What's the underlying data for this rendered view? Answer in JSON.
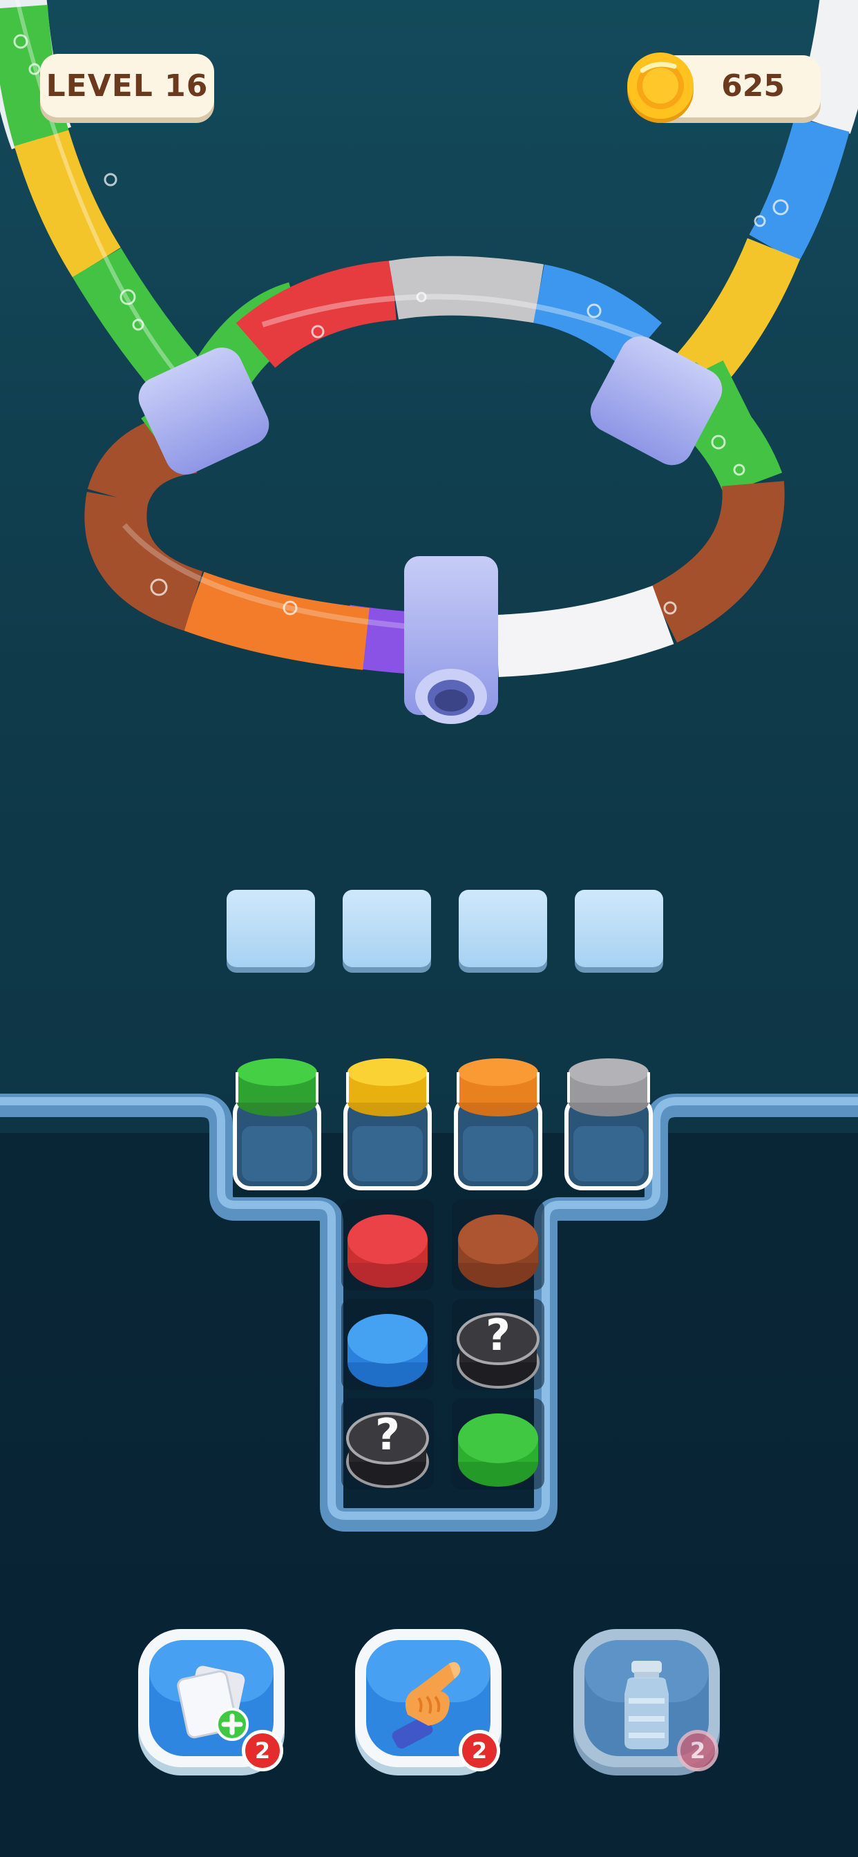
{
  "hud": {
    "level_label": "LEVEL 16",
    "coins": "625"
  },
  "pipe_segments": {
    "outer_left": [
      "white",
      "green",
      "yellow",
      "green"
    ],
    "outer_right": [
      "white",
      "blue",
      "yellow",
      "green"
    ],
    "inner_top": [
      "green",
      "red",
      "gray",
      "blue"
    ],
    "inner_bottom": [
      "brown",
      "orange",
      "purple",
      "white",
      "brown"
    ]
  },
  "slots": {
    "count": 4,
    "filled": 0
  },
  "tray": {
    "top_row": [
      "green",
      "yellow",
      "orange",
      "gray"
    ],
    "column_left": [
      "red",
      "blue",
      "hidden"
    ],
    "column_right": [
      "brown",
      "hidden",
      "green"
    ],
    "hidden_symbol": "?"
  },
  "colors": {
    "green": "#3dc93f",
    "yellow": "#f5c623",
    "orange": "#f7922c",
    "gray": "#a9a9ad",
    "red": "#e63b3f",
    "brown": "#a5502d",
    "blue": "#3d97ef",
    "hidden": "#3a3a3e",
    "purple": "#8b52e6",
    "white": "#f4f4f6"
  },
  "boosters": [
    {
      "name": "add-slot",
      "icon": "cards-plus-icon",
      "count": "2",
      "enabled": true
    },
    {
      "name": "hint",
      "icon": "pointing-hand-icon",
      "count": "2",
      "enabled": true
    },
    {
      "name": "bottle",
      "icon": "bottle-icon",
      "count": "2",
      "enabled": false
    }
  ]
}
